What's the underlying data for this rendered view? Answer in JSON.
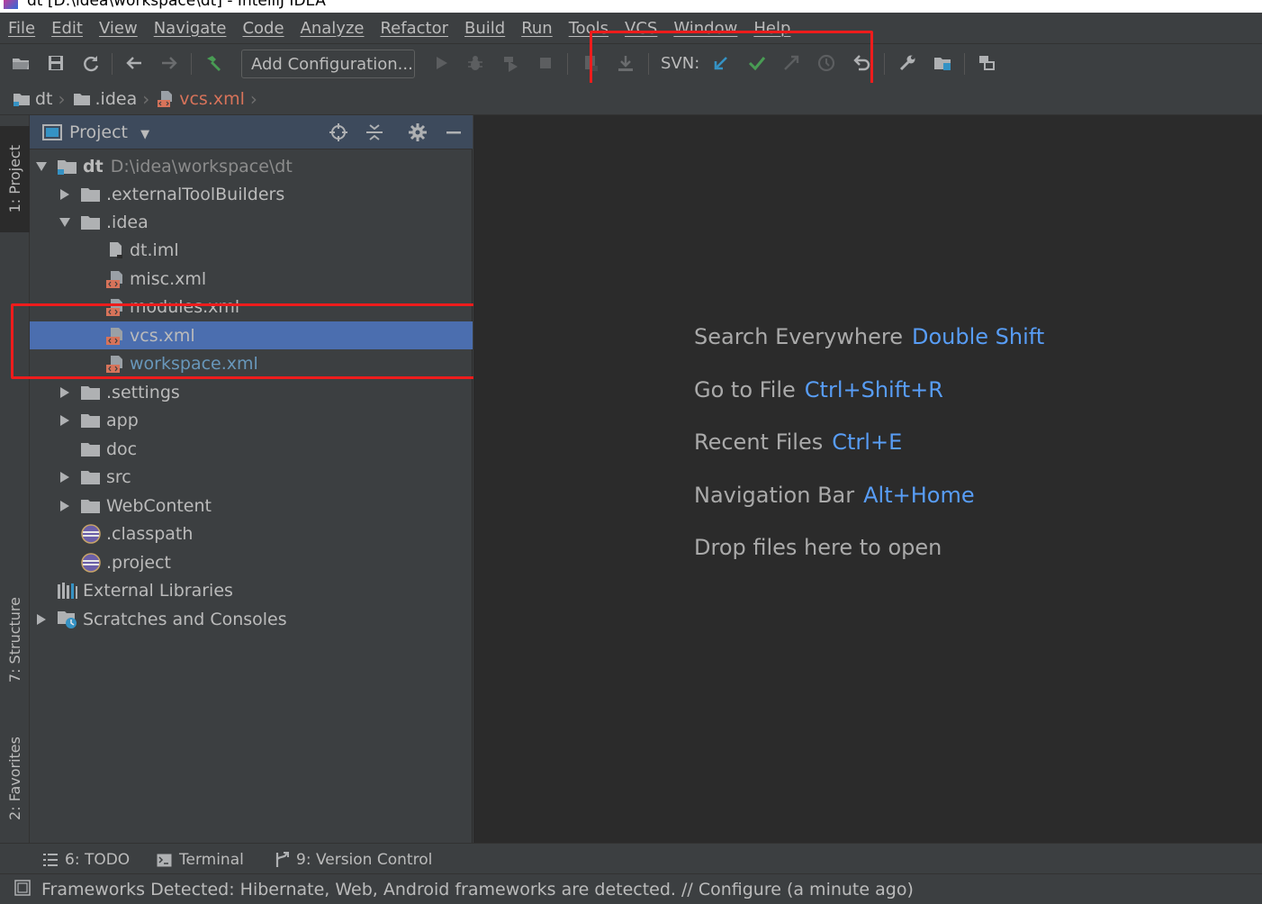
{
  "window": {
    "title": "dt [D:\\idea\\workspace\\dt] - IntelliJ IDEA"
  },
  "menu": [
    "File",
    "Edit",
    "View",
    "Navigate",
    "Code",
    "Analyze",
    "Refactor",
    "Build",
    "Run",
    "Tools",
    "VCS",
    "Window",
    "Help"
  ],
  "toolbar": {
    "add_configuration": "Add Configuration...",
    "svn_label": "SVN:"
  },
  "breadcrumb": [
    "dt",
    ".idea",
    "vcs.xml"
  ],
  "side_tabs": {
    "project": "1: Project",
    "structure": "7: Structure",
    "favorites": "2: Favorites"
  },
  "project_panel": {
    "title": "Project",
    "tree": [
      {
        "label": "dt",
        "path": "D:\\idea\\workspace\\dt"
      },
      {
        "label": ".externalToolBuilders"
      },
      {
        "label": ".idea"
      },
      {
        "label": "dt.iml"
      },
      {
        "label": "misc.xml"
      },
      {
        "label": "modules.xml"
      },
      {
        "label": "vcs.xml"
      },
      {
        "label": "workspace.xml"
      },
      {
        "label": ".settings"
      },
      {
        "label": "app"
      },
      {
        "label": "doc"
      },
      {
        "label": "src"
      },
      {
        "label": "WebContent"
      },
      {
        "label": ".classpath"
      },
      {
        "label": ".project"
      },
      {
        "label": "External Libraries"
      },
      {
        "label": "Scratches and Consoles"
      }
    ]
  },
  "editor_hints": [
    {
      "text": "Search Everywhere",
      "key": "Double Shift"
    },
    {
      "text": "Go to File",
      "key": "Ctrl+Shift+R"
    },
    {
      "text": "Recent Files",
      "key": "Ctrl+E"
    },
    {
      "text": "Navigation Bar",
      "key": "Alt+Home"
    },
    {
      "text": "Drop files here to open",
      "key": ""
    }
  ],
  "bottom_tabs": [
    "6: TODO",
    "Terminal",
    "9: Version Control"
  ],
  "status": "Frameworks Detected: Hibernate, Web, Android frameworks are detected. // Configure (a minute ago)",
  "colors": {
    "accent_blue": "#589df6",
    "selection": "#4b6eaf",
    "highlight_box": "#ee1c1c",
    "svn_check": "#499c54"
  }
}
